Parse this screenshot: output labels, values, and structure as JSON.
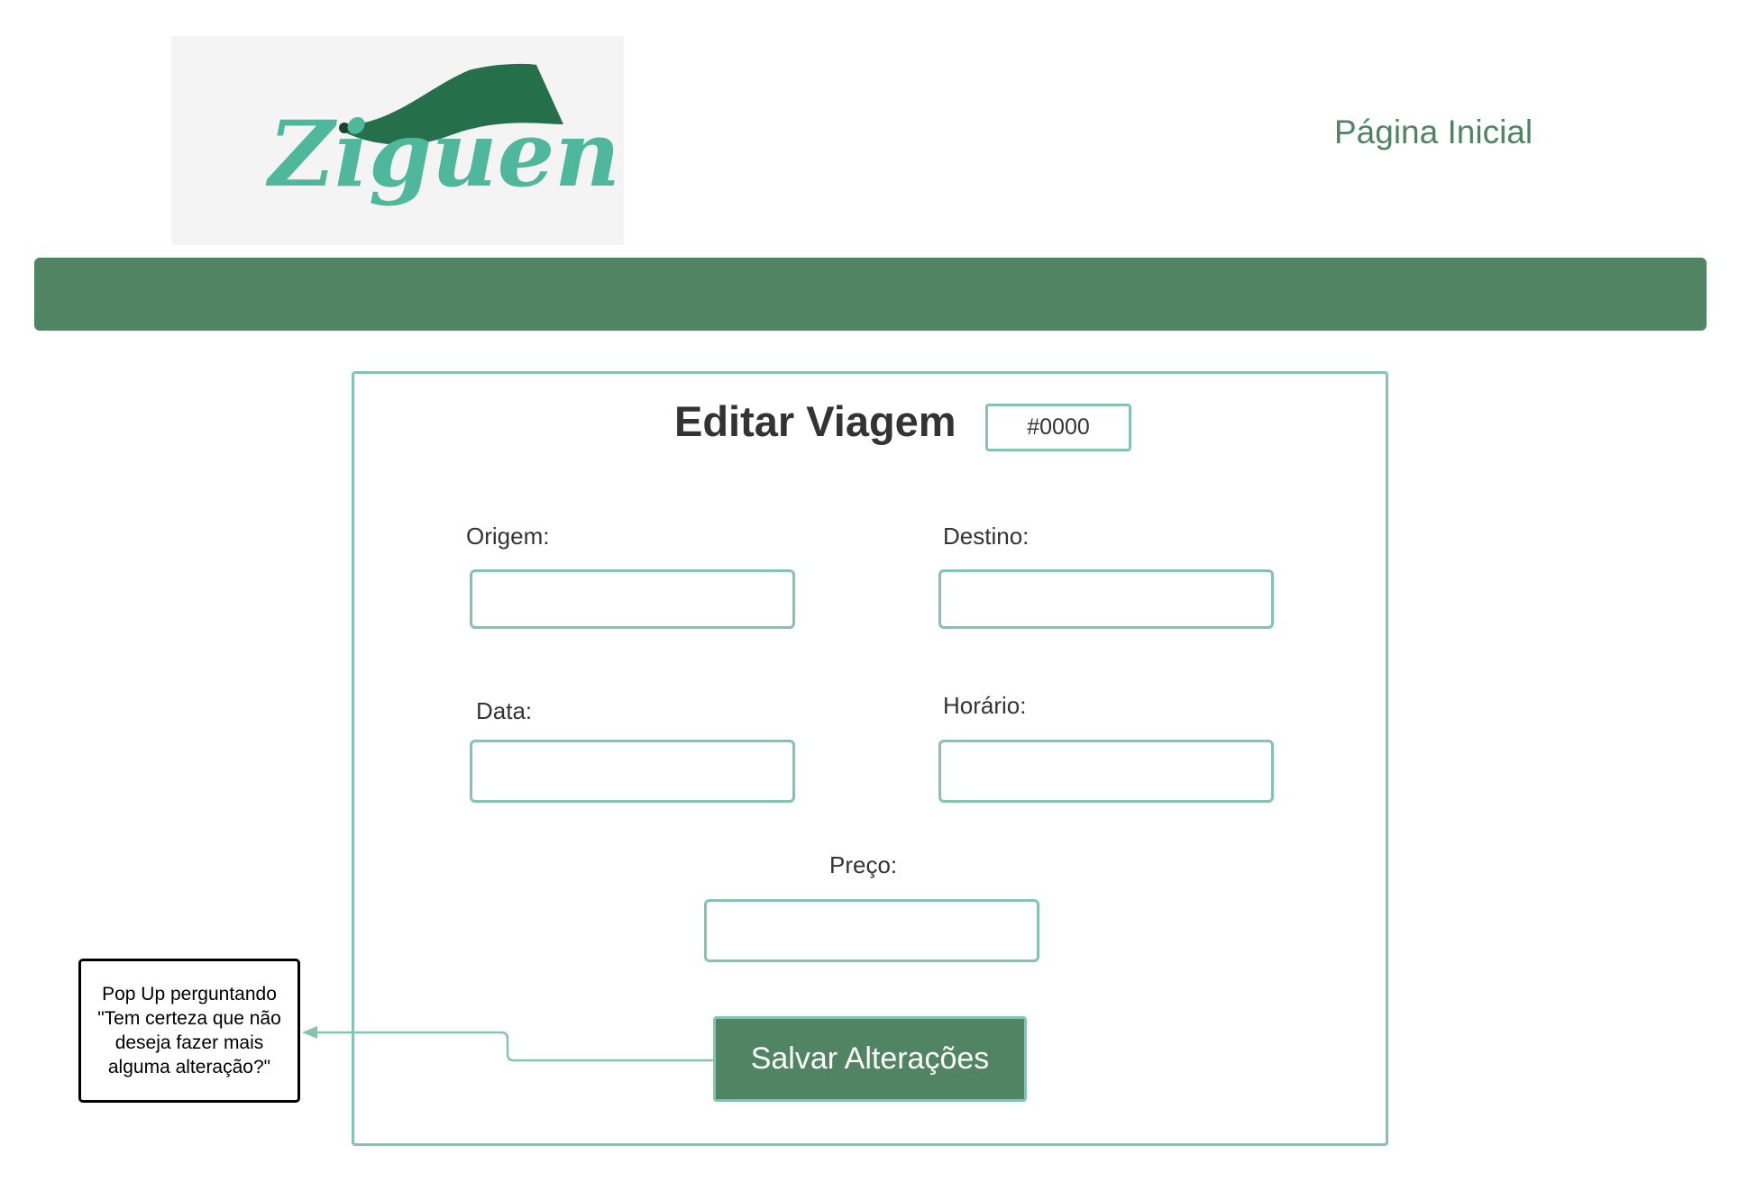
{
  "header": {
    "logo_text": "Ziguen",
    "nav_home_label": "Página Inicial"
  },
  "form": {
    "title": "Editar Viagem",
    "trip_id": "#0000",
    "fields": {
      "origem": {
        "label": "Origem:",
        "value": ""
      },
      "destino": {
        "label": "Destino:",
        "value": ""
      },
      "data": {
        "label": "Data:",
        "value": ""
      },
      "horario": {
        "label": "Horário:",
        "value": ""
      },
      "preco": {
        "label": "Preço:",
        "value": ""
      }
    },
    "save_label": "Salvar Alterações"
  },
  "annotation": {
    "text": "Pop Up perguntando\n\"Tem certeza que não\ndeseja fazer mais\nalguma alteração?\""
  },
  "colors": {
    "brand_green": "#508463",
    "accent_teal": "#84c3ad",
    "logo_teal": "#4fb89c",
    "logo_dark": "#25704a"
  }
}
